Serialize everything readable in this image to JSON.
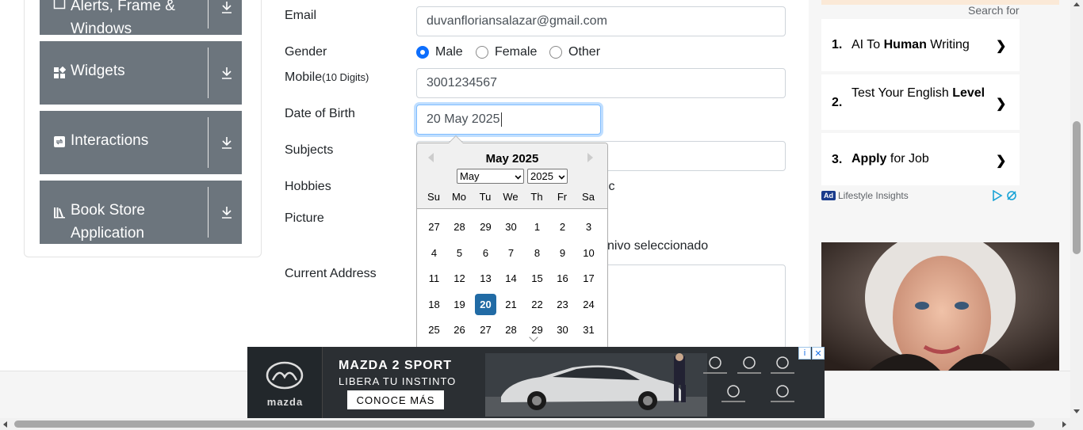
{
  "sidebar": {
    "items": [
      {
        "label": "Alerts, Frame & Windows",
        "icon": "window-icon"
      },
      {
        "label": "Widgets",
        "icon": "widgets-icon"
      },
      {
        "label": "Interactions",
        "icon": "interactions-icon"
      },
      {
        "label": "Book Store Application",
        "icon": "book-icon"
      }
    ]
  },
  "form": {
    "email_label": "Email",
    "email_value": "duvanfloriansalazar@gmail.com",
    "gender_label": "Gender",
    "gender_options": [
      "Male",
      "Female",
      "Other"
    ],
    "gender_selected": "Male",
    "mobile_label": "Mobile",
    "mobile_hint": "(10 Digits)",
    "mobile_value": "3001234567",
    "dob_label": "Date of Birth",
    "dob_value": "20 May 2025",
    "subjects_label": "Subjects",
    "hobbies_label": "Hobbies",
    "hobbies_partial": "ic",
    "picture_label": "Picture",
    "picture_status": "nivo seleccionado",
    "address_label": "Current Address"
  },
  "datepicker": {
    "title": "May 2025",
    "month_select": "May",
    "year_select": "2025",
    "weekdays": [
      "Su",
      "Mo",
      "Tu",
      "We",
      "Th",
      "Fr",
      "Sa"
    ],
    "weeks": [
      [
        "27",
        "28",
        "29",
        "30",
        "1",
        "2",
        "3"
      ],
      [
        "4",
        "5",
        "6",
        "7",
        "8",
        "9",
        "10"
      ],
      [
        "11",
        "12",
        "13",
        "14",
        "15",
        "16",
        "17"
      ],
      [
        "18",
        "19",
        "20",
        "21",
        "22",
        "23",
        "24"
      ],
      [
        "25",
        "26",
        "27",
        "28",
        "29",
        "30",
        "31"
      ]
    ],
    "selected_day": "20"
  },
  "right_ad": {
    "search_for": "Search for",
    "items": [
      {
        "num": "1.",
        "pre": "AI To ",
        "bold": "Human",
        "post": " Writing"
      },
      {
        "num": "2.",
        "pre": "Test Your English ",
        "bold": "Level",
        "post": ""
      },
      {
        "num": "3.",
        "pre": "",
        "bold": "Apply",
        "post": " for Job"
      }
    ],
    "chevron": "❯",
    "badge": "Ad",
    "sponsor": "Lifestyle Insights"
  },
  "banner": {
    "brand": "mazda",
    "headline": "MAZDA 2 SPORT",
    "sub": "LIBERA TU INSTINTO",
    "cta": "CONOCE MÁS",
    "info": "i",
    "close": "✕"
  },
  "colors": {
    "nav_card": "#6c757d",
    "primary": "#0d6efd",
    "dp_selected": "#216ba5",
    "input_focus": "#80bdff"
  }
}
